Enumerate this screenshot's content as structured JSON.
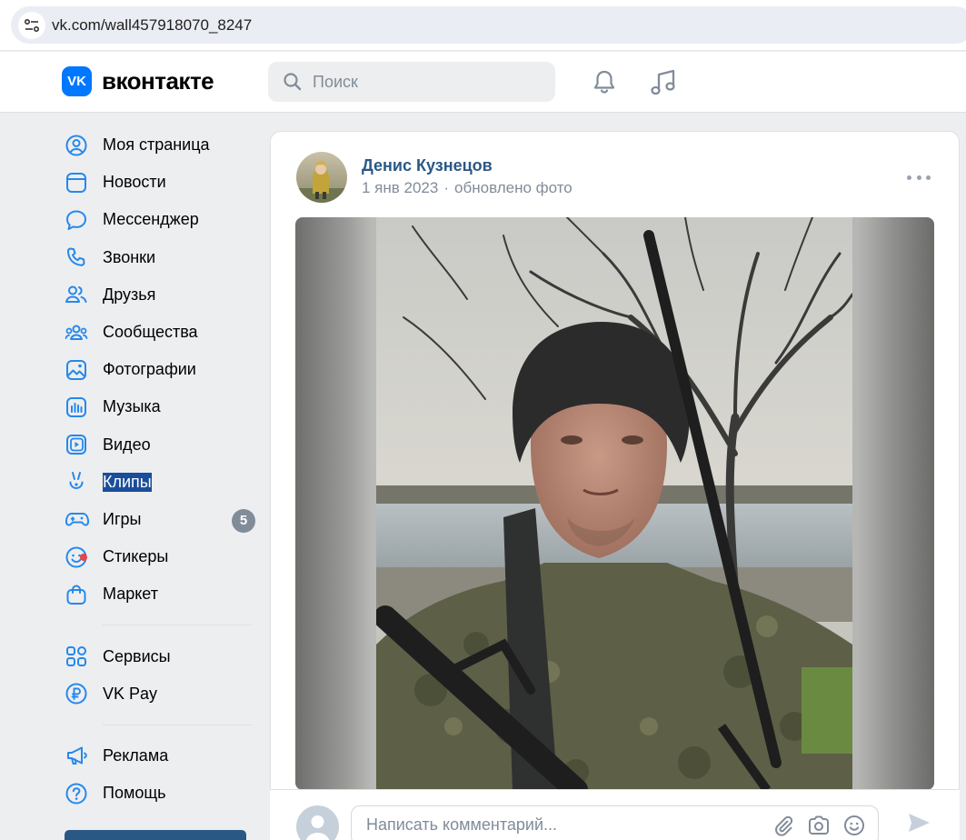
{
  "browser": {
    "url": "vk.com/wall457918070_8247"
  },
  "header": {
    "logo_text": "вконтакте",
    "logo_mark": "VK",
    "search_placeholder": "Поиск"
  },
  "sidebar": {
    "items": [
      {
        "label": "Моя страница",
        "icon": "user-circle-icon"
      },
      {
        "label": "Новости",
        "icon": "news-icon"
      },
      {
        "label": "Мессенджер",
        "icon": "message-icon"
      },
      {
        "label": "Звонки",
        "icon": "phone-icon"
      },
      {
        "label": "Друзья",
        "icon": "friends-icon"
      },
      {
        "label": "Сообщества",
        "icon": "communities-icon"
      },
      {
        "label": "Фотографии",
        "icon": "photo-icon"
      },
      {
        "label": "Музыка",
        "icon": "music-icon"
      },
      {
        "label": "Видео",
        "icon": "video-icon"
      },
      {
        "label": "Клипы",
        "icon": "clips-icon",
        "selected": true
      },
      {
        "label": "Игры",
        "icon": "gamepad-icon",
        "badge": "5"
      },
      {
        "label": "Стикеры",
        "icon": "sticker-icon"
      },
      {
        "label": "Маркет",
        "icon": "market-icon"
      }
    ],
    "secondary": [
      {
        "label": "Сервисы",
        "icon": "services-icon"
      },
      {
        "label": "VK Pay",
        "icon": "vkpay-icon"
      }
    ],
    "tertiary": [
      {
        "label": "Реклама",
        "icon": "megaphone-icon"
      },
      {
        "label": "Помощь",
        "icon": "help-icon"
      }
    ]
  },
  "post": {
    "author": "Денис Кузнецов",
    "date": "1 янв 2023",
    "separator": "·",
    "action": "обновлено фото"
  },
  "comment": {
    "placeholder": "Написать комментарий..."
  },
  "colors": {
    "accent": "#0077ff",
    "link": "#2a5885",
    "muted": "#818c99",
    "icon": "#2688eb",
    "background": "#edeef0"
  }
}
